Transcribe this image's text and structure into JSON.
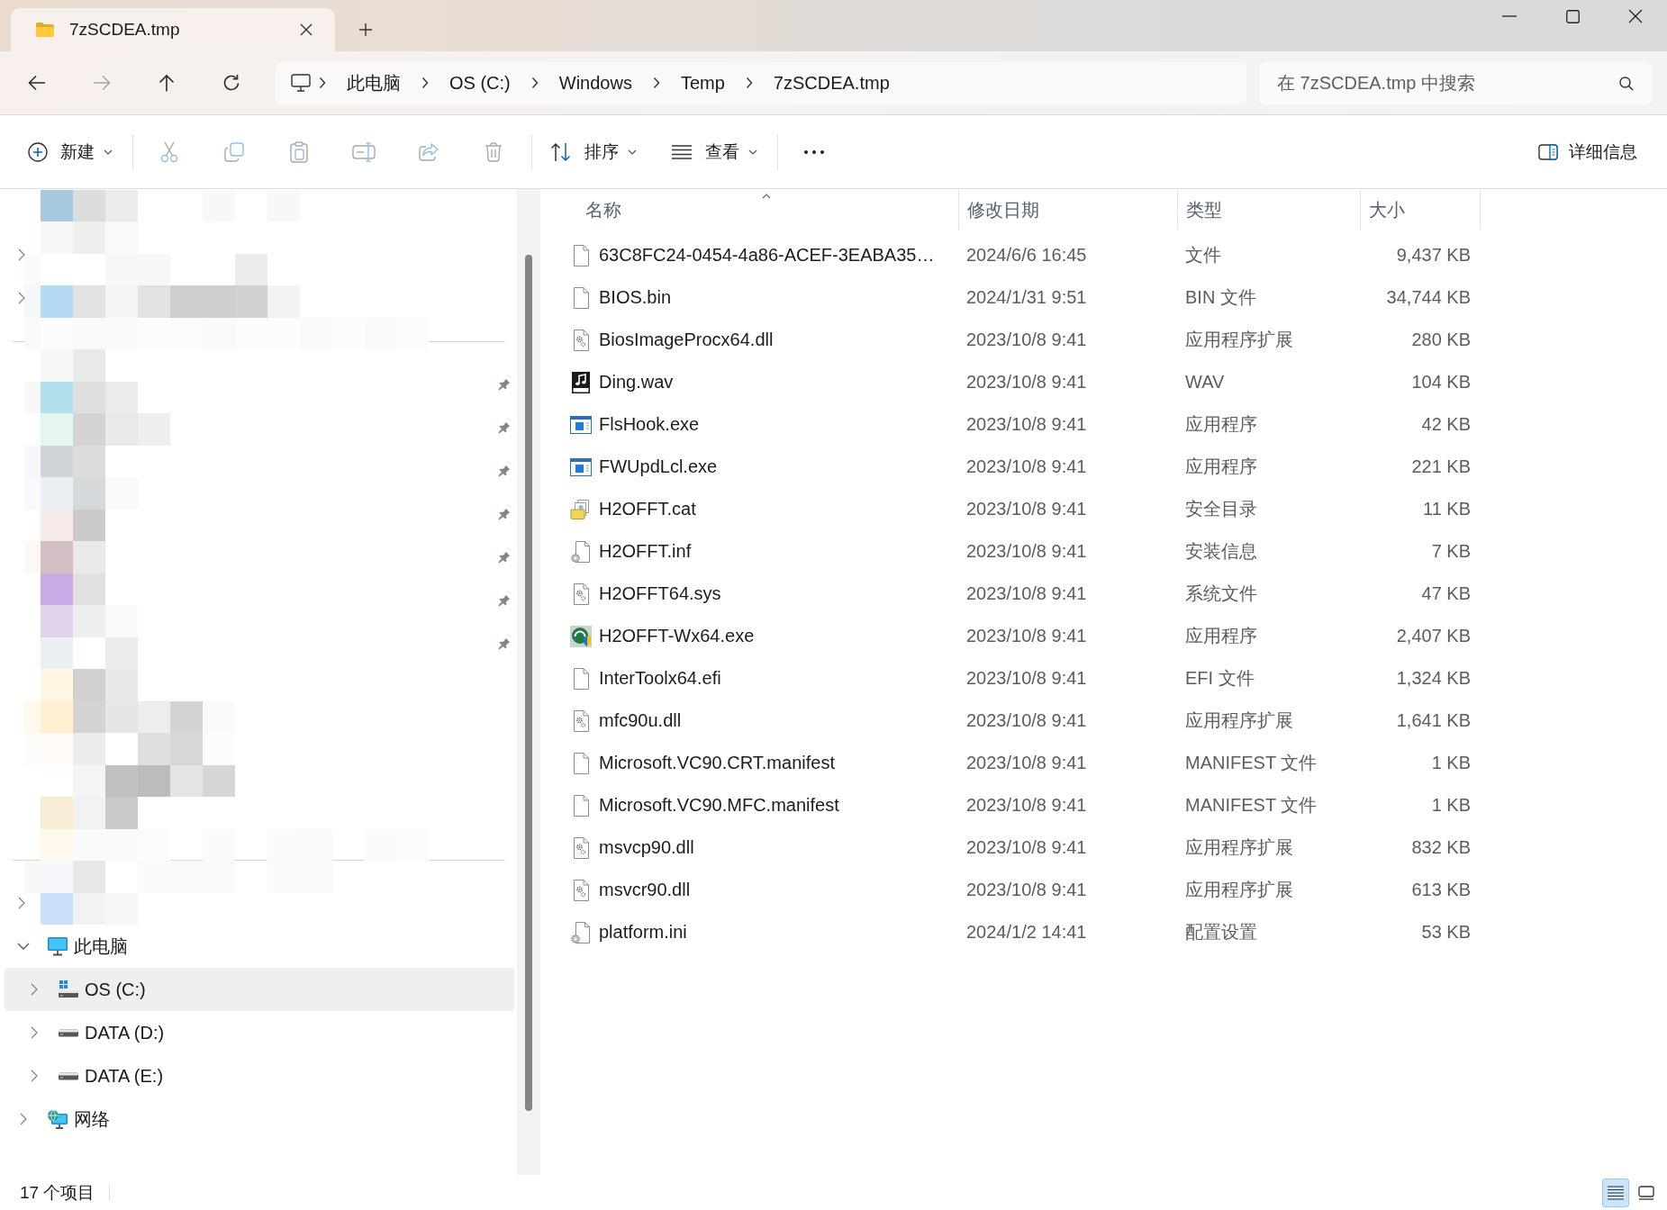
{
  "tabs": [
    {
      "title": "7zSCDEA.tmp",
      "selected": true
    }
  ],
  "navigation": {
    "buttons": [
      {
        "kind": "back",
        "disabled": false
      },
      {
        "kind": "forward",
        "disabled": true
      },
      {
        "kind": "up",
        "disabled": false
      },
      {
        "kind": "refresh",
        "disabled": false
      }
    ],
    "breadcrumbs": [
      "此电脑",
      "OS (C:)",
      "Windows",
      "Temp",
      "7zSCDEA.tmp"
    ],
    "search": {
      "placeholder": "在 7zSCDEA.tmp 中搜索"
    }
  },
  "toolbar": {
    "groups": [
      {
        "buttons": [
          {
            "kind": "new",
            "label": "新建",
            "dropdown": true,
            "disabled": false
          }
        ]
      },
      {
        "buttons": [
          {
            "kind": "cut",
            "disabled": true
          },
          {
            "kind": "copy",
            "disabled": true
          },
          {
            "kind": "paste",
            "disabled": true
          },
          {
            "kind": "rename",
            "disabled": true
          },
          {
            "kind": "share",
            "disabled": true
          },
          {
            "kind": "delete",
            "disabled": true
          }
        ]
      },
      {
        "buttons": [
          {
            "kind": "sort",
            "label": "排序",
            "dropdown": true,
            "disabled": false
          },
          {
            "kind": "view",
            "label": "查看",
            "dropdown": true,
            "disabled": false
          }
        ]
      },
      {
        "buttons": [
          {
            "kind": "more",
            "disabled": false
          }
        ]
      }
    ],
    "details_pane": {
      "label": "详细信息"
    }
  },
  "navigation_pane": {
    "obscured_rows": [
      {
        "kind": "item",
        "expandable": false,
        "pinned": false
      },
      {
        "kind": "item",
        "expandable": true,
        "pinned": false
      },
      {
        "kind": "item",
        "expandable": true,
        "pinned": false
      },
      {
        "kind": "divider"
      },
      {
        "kind": "item",
        "expandable": false,
        "pinned": true
      },
      {
        "kind": "item",
        "expandable": false,
        "pinned": true
      },
      {
        "kind": "item",
        "expandable": false,
        "pinned": true
      },
      {
        "kind": "item",
        "expandable": false,
        "pinned": true
      },
      {
        "kind": "item",
        "expandable": false,
        "pinned": true
      },
      {
        "kind": "item",
        "expandable": false,
        "pinned": true
      },
      {
        "kind": "item",
        "expandable": false,
        "pinned": true
      },
      {
        "kind": "item",
        "expandable": false,
        "pinned": false
      },
      {
        "kind": "item",
        "expandable": false,
        "pinned": false
      },
      {
        "kind": "item",
        "expandable": false,
        "pinned": false
      },
      {
        "kind": "item",
        "expandable": false,
        "pinned": false
      },
      {
        "kind": "divider"
      },
      {
        "kind": "item",
        "expandable": true,
        "pinned": false
      }
    ],
    "tree": [
      {
        "label": "此电脑",
        "kind": "computer",
        "expanded": true,
        "selected": false,
        "children": [
          {
            "label": "OS (C:)",
            "kind": "system-drive",
            "expanded": false,
            "selected": true
          },
          {
            "label": "DATA (D:)",
            "kind": "drive",
            "expanded": false,
            "selected": false
          },
          {
            "label": "DATA (E:)",
            "kind": "drive",
            "expanded": false,
            "selected": false
          }
        ]
      },
      {
        "label": "网络",
        "kind": "network",
        "expanded": false,
        "selected": false
      }
    ]
  },
  "file_list": {
    "columns": [
      {
        "label": "名称",
        "sorted": true
      },
      {
        "label": "修改日期",
        "sorted": false
      },
      {
        "label": "类型",
        "sorted": false
      },
      {
        "label": "大小",
        "sorted": false
      }
    ],
    "files": [
      {
        "name": "63C8FC24-0454-4a86-ACEF-3EABA35…",
        "modified": "2024/6/6 16:45",
        "type": "文件",
        "size": "9,437 KB",
        "kind": "blank"
      },
      {
        "name": "BIOS.bin",
        "modified": "2024/1/31 9:51",
        "type": "BIN 文件",
        "size": "34,744 KB",
        "kind": "blank"
      },
      {
        "name": "BiosImageProcx64.dll",
        "modified": "2023/10/8 9:41",
        "type": "应用程序扩展",
        "size": "280 KB",
        "kind": "library"
      },
      {
        "name": "Ding.wav",
        "modified": "2023/10/8 9:41",
        "type": "WAV",
        "size": "104 KB",
        "kind": "audio"
      },
      {
        "name": "FlsHook.exe",
        "modified": "2023/10/8 9:41",
        "type": "应用程序",
        "size": "42 KB",
        "kind": "program"
      },
      {
        "name": "FWUpdLcl.exe",
        "modified": "2023/10/8 9:41",
        "type": "应用程序",
        "size": "221 KB",
        "kind": "program"
      },
      {
        "name": "H2OFFT.cat",
        "modified": "2023/10/8 9:41",
        "type": "安全目录",
        "size": "11 KB",
        "kind": "catalog"
      },
      {
        "name": "H2OFFT.inf",
        "modified": "2023/10/8 9:41",
        "type": "安装信息",
        "size": "7 KB",
        "kind": "config"
      },
      {
        "name": "H2OFFT64.sys",
        "modified": "2023/10/8 9:41",
        "type": "系统文件",
        "size": "47 KB",
        "kind": "library"
      },
      {
        "name": "H2OFFT-Wx64.exe",
        "modified": "2023/10/8 9:41",
        "type": "应用程序",
        "size": "2,407 KB",
        "kind": "app-logo"
      },
      {
        "name": "InterToolx64.efi",
        "modified": "2023/10/8 9:41",
        "type": "EFI 文件",
        "size": "1,324 KB",
        "kind": "blank"
      },
      {
        "name": "mfc90u.dll",
        "modified": "2023/10/8 9:41",
        "type": "应用程序扩展",
        "size": "1,641 KB",
        "kind": "library"
      },
      {
        "name": "Microsoft.VC90.CRT.manifest",
        "modified": "2023/10/8 9:41",
        "type": "MANIFEST 文件",
        "size": "1 KB",
        "kind": "blank"
      },
      {
        "name": "Microsoft.VC90.MFC.manifest",
        "modified": "2023/10/8 9:41",
        "type": "MANIFEST 文件",
        "size": "1 KB",
        "kind": "blank"
      },
      {
        "name": "msvcp90.dll",
        "modified": "2023/10/8 9:41",
        "type": "应用程序扩展",
        "size": "832 KB",
        "kind": "library"
      },
      {
        "name": "msvcr90.dll",
        "modified": "2023/10/8 9:41",
        "type": "应用程序扩展",
        "size": "613 KB",
        "kind": "library"
      },
      {
        "name": "platform.ini",
        "modified": "2024/1/2 14:41",
        "type": "配置设置",
        "size": "53 KB",
        "kind": "config"
      }
    ]
  },
  "status_bar": {
    "item_count": "17 个项目",
    "views": [
      {
        "kind": "details",
        "selected": true
      },
      {
        "kind": "tiles",
        "selected": false
      }
    ]
  }
}
